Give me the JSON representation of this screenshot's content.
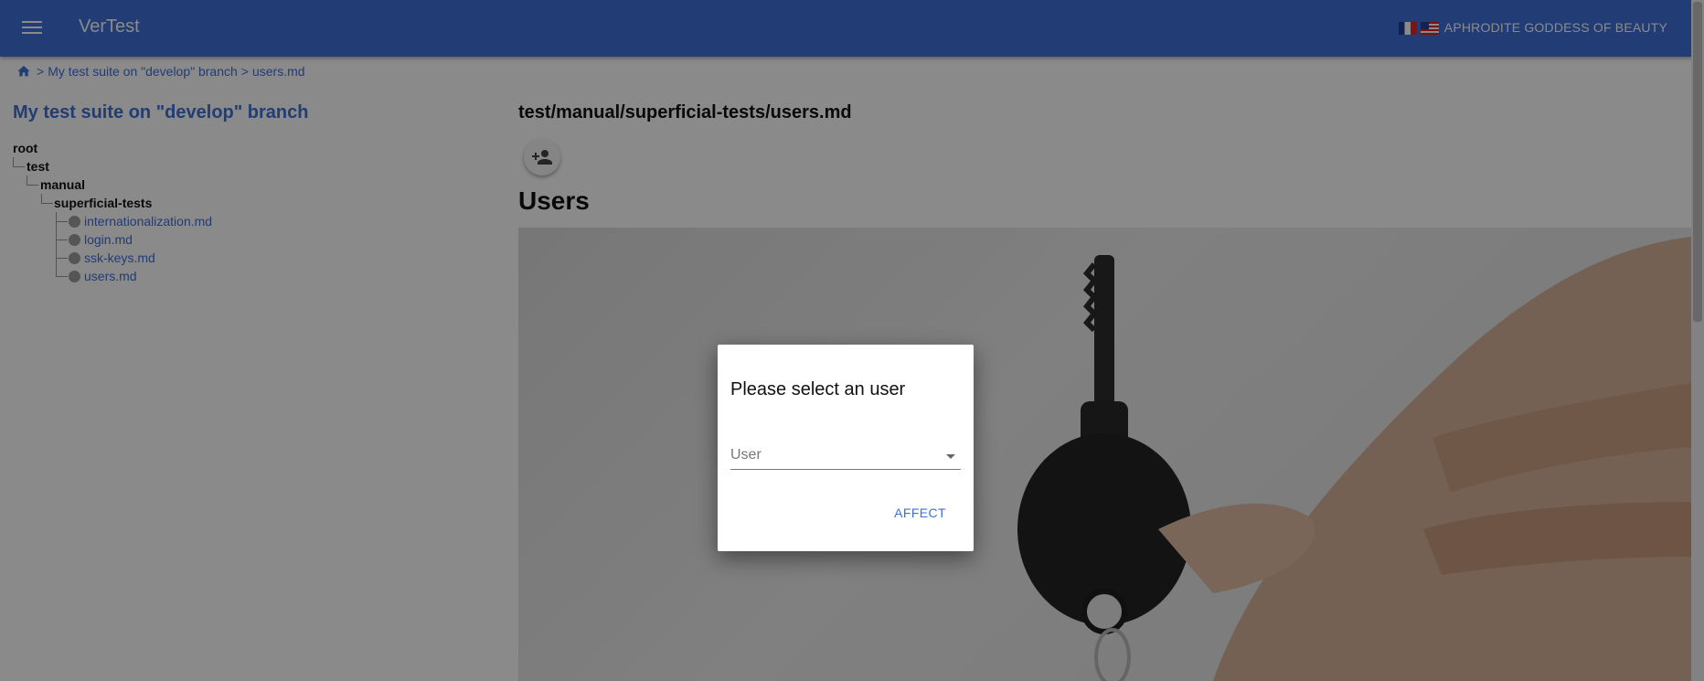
{
  "header": {
    "app_title": "VerTest",
    "user_name": "APHRODITE GODDESS OF BEAUTY",
    "flags": [
      "fr-flag-icon",
      "us-flag-icon"
    ],
    "color": "#3f6fd8"
  },
  "breadcrumb": {
    "sep1": ">",
    "suite": "My test suite on \"develop\" branch",
    "sep2": ">",
    "file": "users.md"
  },
  "sidebar": {
    "suite_title": "My test suite on \"develop\" branch",
    "tree": {
      "root": "root",
      "test": "test",
      "manual": "manual",
      "superficial": "superficial-tests",
      "files": [
        "internationalization.md",
        "login.md",
        "ssk-keys.md",
        "users.md"
      ]
    }
  },
  "main": {
    "path_title": "test/manual/superficial-tests/users.md",
    "heading": "Users"
  },
  "dialog": {
    "title": "Please select an user",
    "select_label": "User",
    "affect_label": "AFFECT"
  }
}
